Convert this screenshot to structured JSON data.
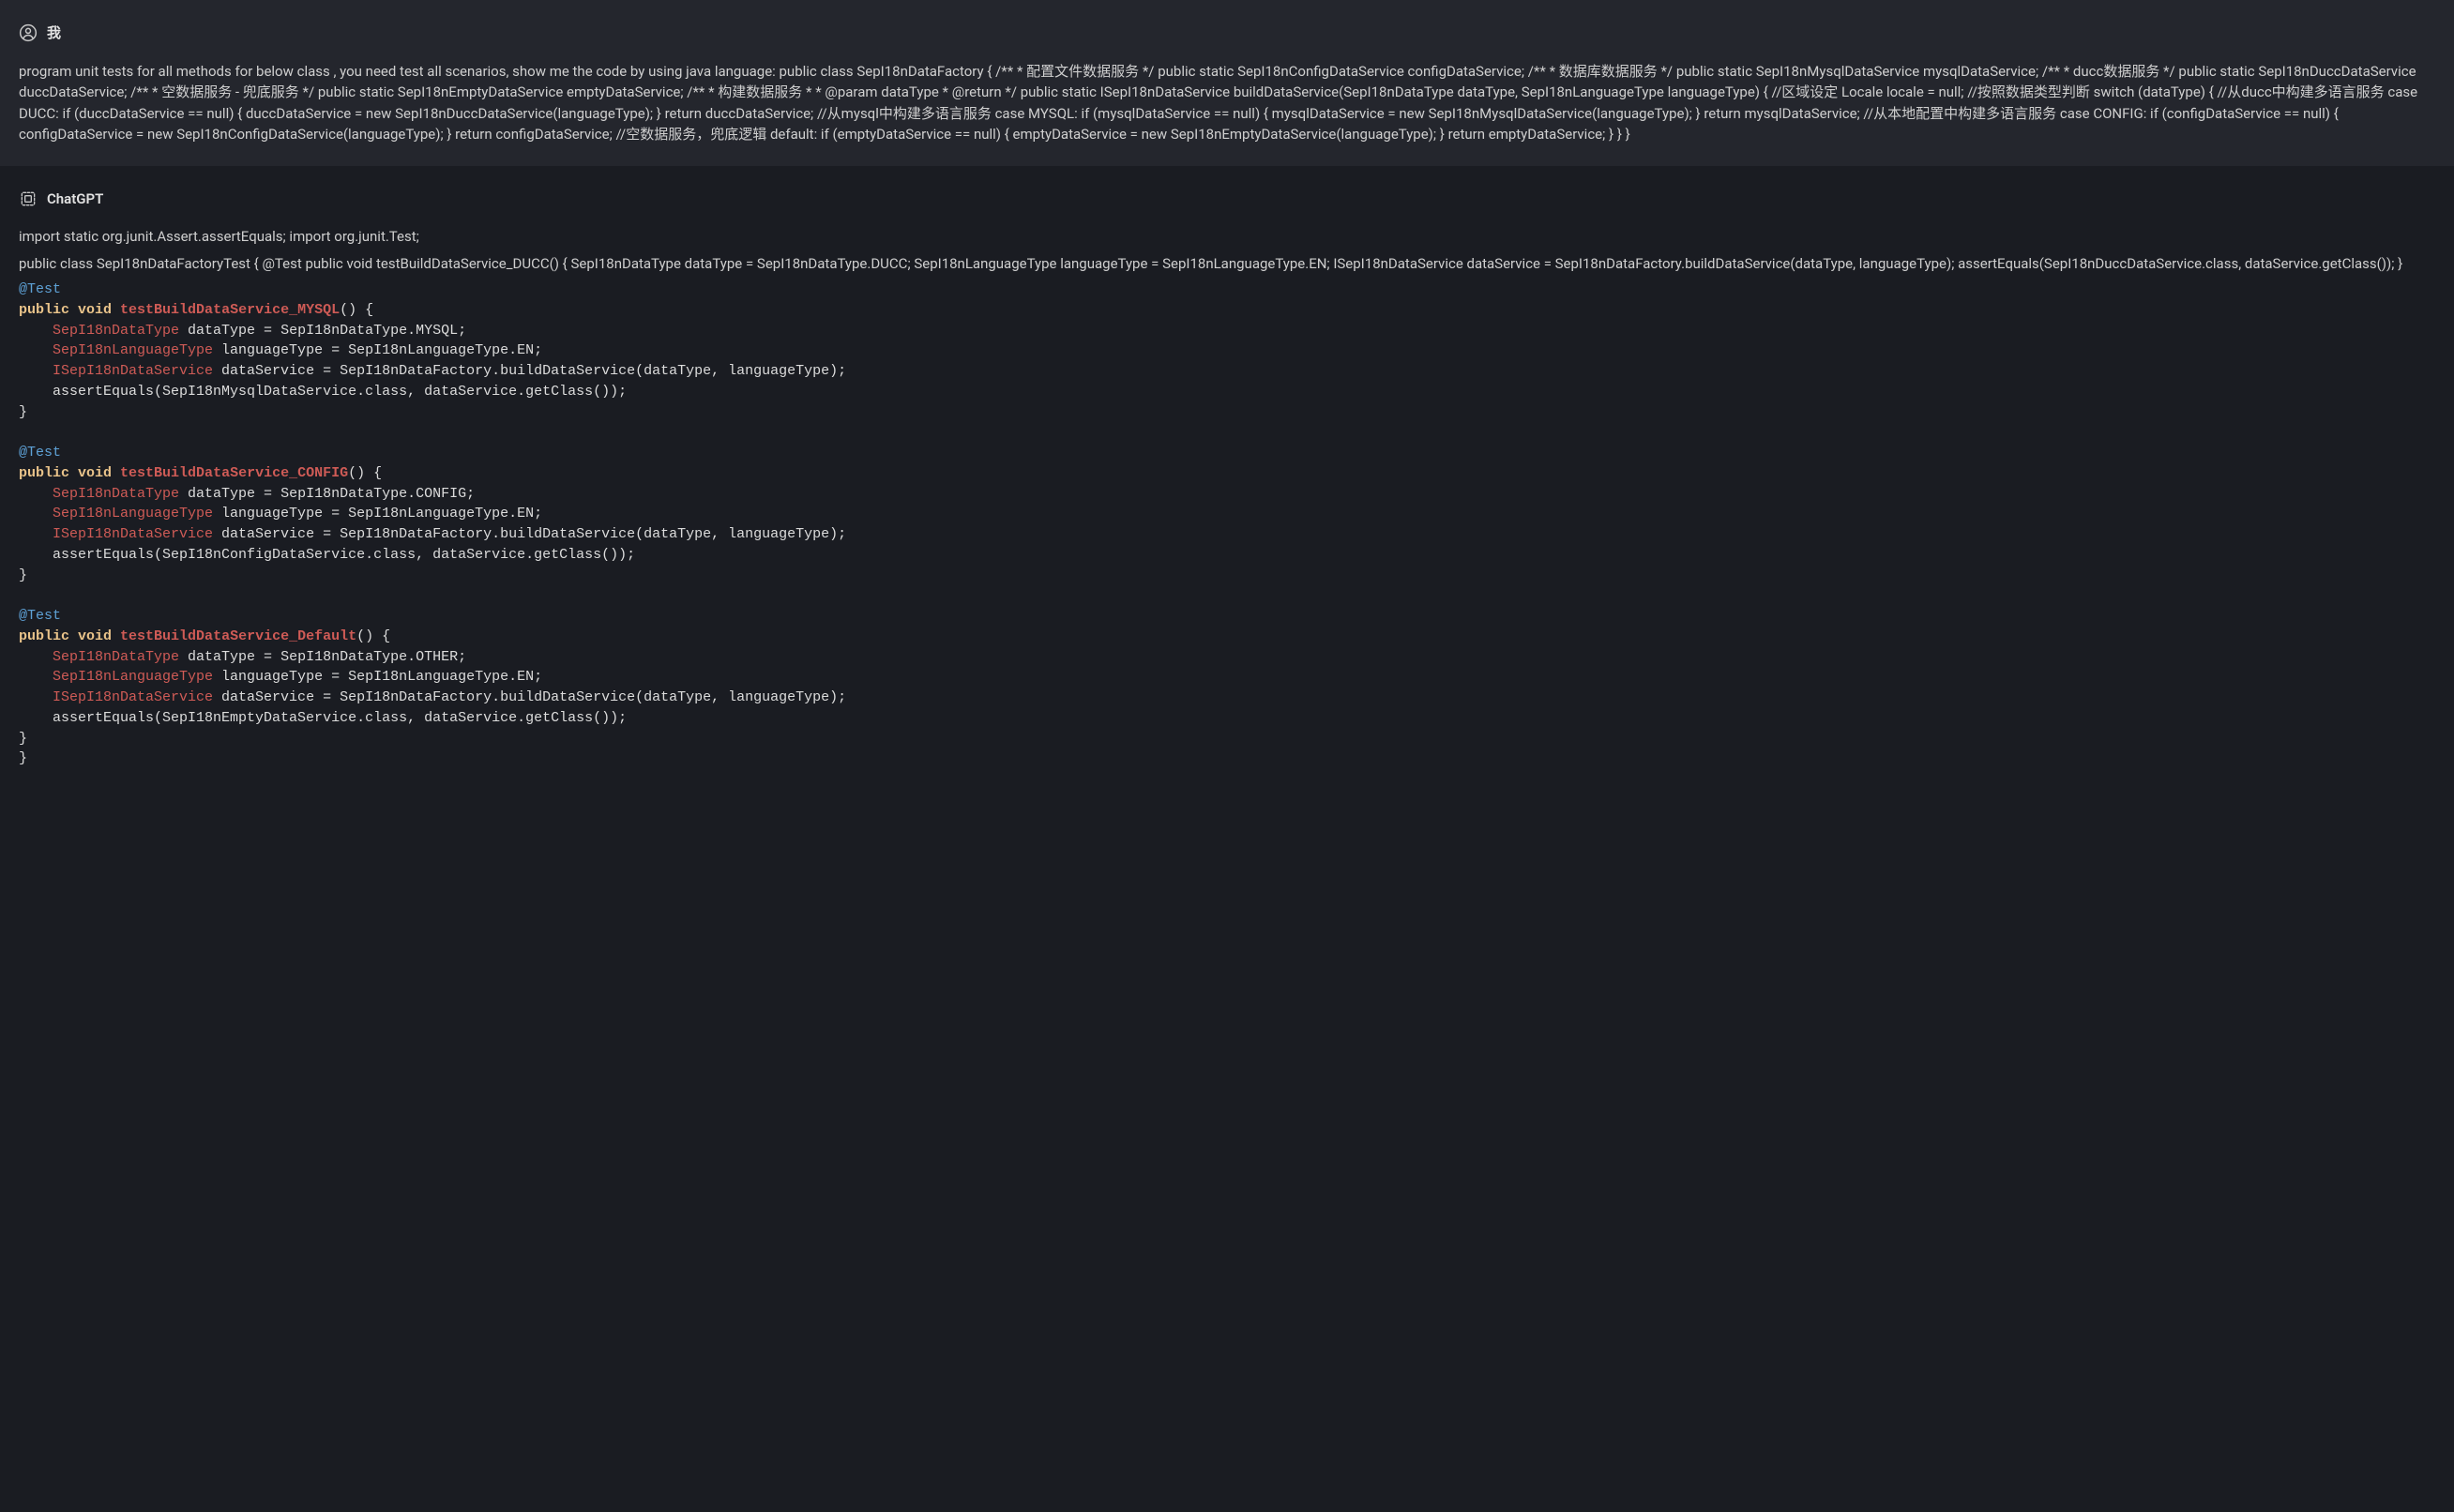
{
  "user": {
    "name": "我",
    "message": "program unit tests for all methods for below class , you need test all scenarios, show me the code by using java language: public class SepI18nDataFactory { /** * 配置文件数据服务 */ public static SepI18nConfigDataService configDataService; /** * 数据库数据服务 */ public static SepI18nMysqlDataService mysqlDataService; /** * ducc数据服务 */ public static SepI18nDuccDataService duccDataService; /** * 空数据服务 - 兜底服务 */ public static SepI18nEmptyDataService emptyDataService; /** * 构建数据服务 * * @param dataType * @return */ public static ISepI18nDataService buildDataService(SepI18nDataType dataType, SepI18nLanguageType languageType) { //区域设定 Locale locale = null; //按照数据类型判断 switch (dataType) { //从ducc中构建多语言服务 case DUCC: if (duccDataService == null) { duccDataService = new SepI18nDuccDataService(languageType); } return duccDataService; //从mysql中构建多语言服务 case MYSQL: if (mysqlDataService == null) { mysqlDataService = new SepI18nMysqlDataService(languageType); } return mysqlDataService; //从本地配置中构建多语言服务 case CONFIG: if (configDataService == null) { configDataService = new SepI18nConfigDataService(languageType); } return configDataService; //空数据服务，兜底逻辑 default: if (emptyDataService == null) { emptyDataService = new SepI18nEmptyDataService(languageType); } return emptyDataService; } } }"
  },
  "assistant": {
    "name": "ChatGPT",
    "intro_line1": "import static org.junit.Assert.assertEquals; import org.junit.Test;",
    "intro_line2": "public class SepI18nDataFactoryTest { @Test public void testBuildDataService_DUCC() { SepI18nDataType dataType = SepI18nDataType.DUCC; SepI18nLanguageType languageType = SepI18nLanguageType.EN; ISepI18nDataService dataService = SepI18nDataFactory.buildDataService(dataType, languageType); assertEquals(SepI18nDuccDataService.class, dataService.getClass()); }",
    "code": {
      "tests": [
        {
          "annotation": "@Test",
          "kw_prefix": "public void",
          "fn_name": "testBuildDataService_MYSQL",
          "sig_suffix": "() {",
          "lines": [
            {
              "indent": "    ",
              "type_token": "SepI18nDataType",
              "rest": " dataType = SepI18nDataType.MYSQL;"
            },
            {
              "indent": "    ",
              "type_token": "SepI18nLanguageType",
              "rest": " languageType = SepI18nLanguageType.EN;"
            },
            {
              "indent": "    ",
              "type_token": "ISepI18nDataService",
              "rest": " dataService = SepI18nDataFactory.buildDataService(dataType, languageType);"
            },
            {
              "indent": "    ",
              "type_token": "",
              "rest": "assertEquals(SepI18nMysqlDataService.class, dataService.getClass());"
            }
          ],
          "close": "}"
        },
        {
          "annotation": "@Test",
          "kw_prefix": "public void",
          "fn_name": "testBuildDataService_CONFIG",
          "sig_suffix": "() {",
          "lines": [
            {
              "indent": "    ",
              "type_token": "SepI18nDataType",
              "rest": " dataType = SepI18nDataType.CONFIG;"
            },
            {
              "indent": "    ",
              "type_token": "SepI18nLanguageType",
              "rest": " languageType = SepI18nLanguageType.EN;"
            },
            {
              "indent": "    ",
              "type_token": "ISepI18nDataService",
              "rest": " dataService = SepI18nDataFactory.buildDataService(dataType, languageType);"
            },
            {
              "indent": "    ",
              "type_token": "",
              "rest": "assertEquals(SepI18nConfigDataService.class, dataService.getClass());"
            }
          ],
          "close": "}"
        },
        {
          "annotation": "@Test",
          "kw_prefix": "public void",
          "fn_name": "testBuildDataService_Default",
          "sig_suffix": "() {",
          "lines": [
            {
              "indent": "    ",
              "type_token": "SepI18nDataType",
              "rest": " dataType = SepI18nDataType.OTHER;"
            },
            {
              "indent": "    ",
              "type_token": "SepI18nLanguageType",
              "rest": " languageType = SepI18nLanguageType.EN;"
            },
            {
              "indent": "    ",
              "type_token": "ISepI18nDataService",
              "rest": " dataService = SepI18nDataFactory.buildDataService(dataType, languageType);"
            },
            {
              "indent": "    ",
              "type_token": "",
              "rest": "assertEquals(SepI18nEmptyDataService.class, dataService.getClass());"
            }
          ],
          "close": "}"
        }
      ],
      "final_close": "}"
    }
  }
}
